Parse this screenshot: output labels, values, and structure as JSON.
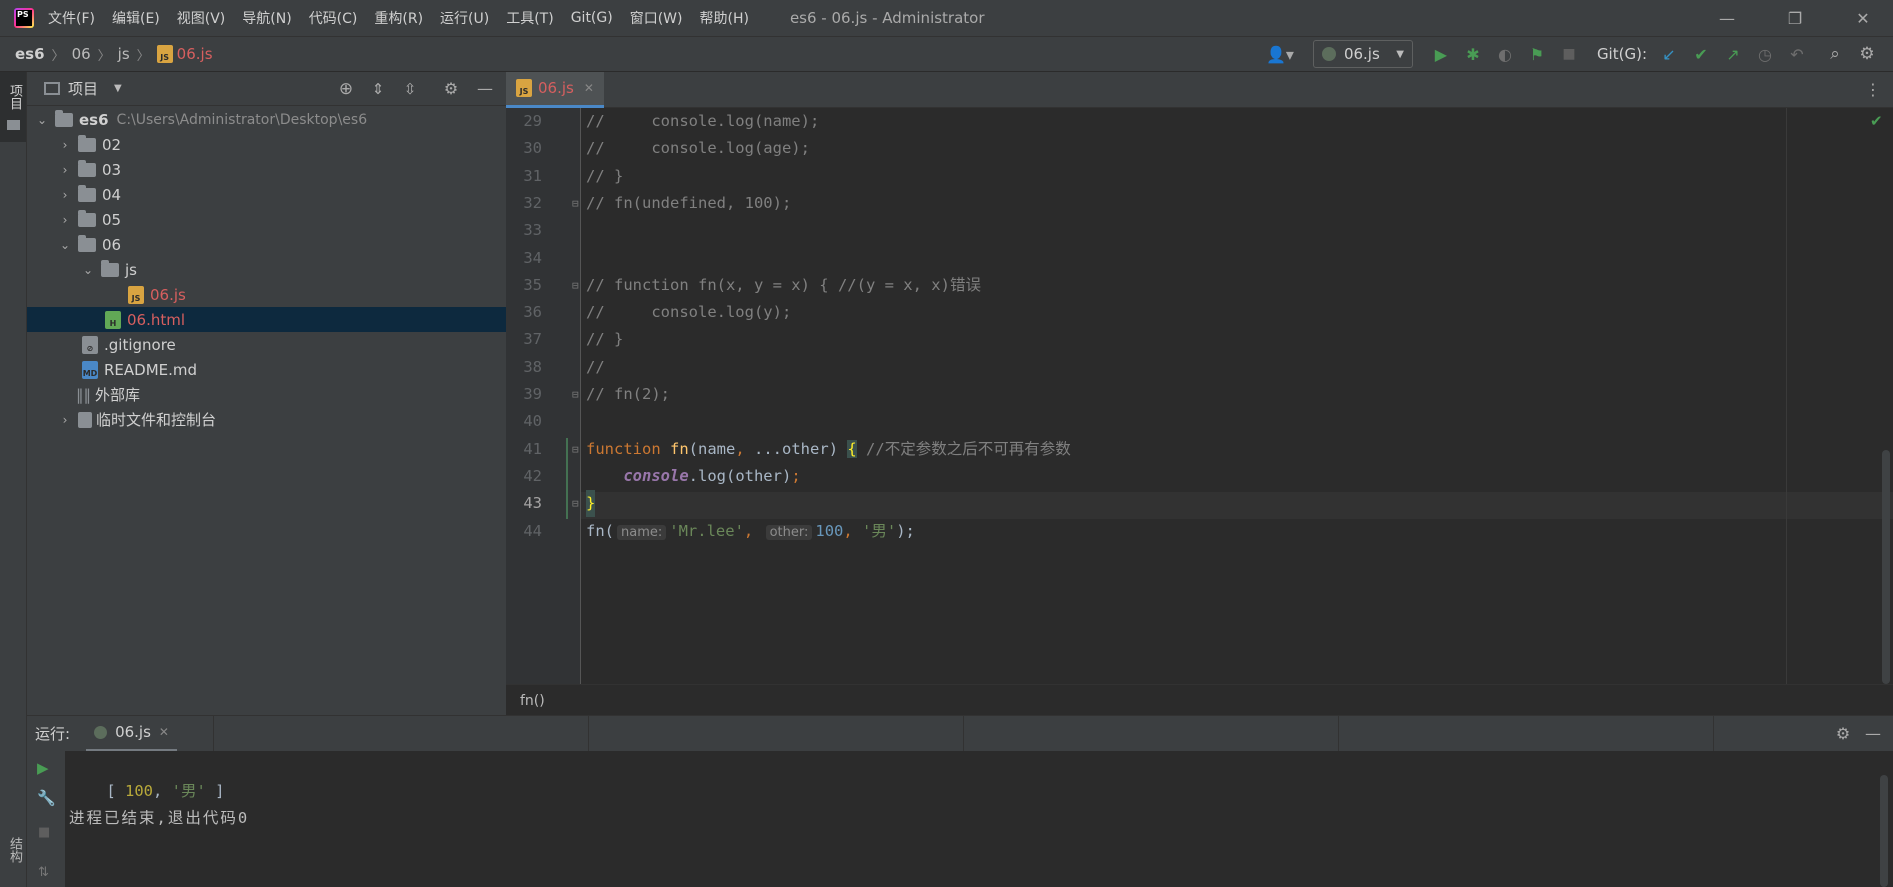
{
  "app_logo": "PS",
  "menu": [
    "文件(F)",
    "编辑(E)",
    "视图(V)",
    "导航(N)",
    "代码(C)",
    "重构(R)",
    "运行(U)",
    "工具(T)",
    "Git(G)",
    "窗口(W)",
    "帮助(H)"
  ],
  "window_title": "es6 - 06.js - Administrator",
  "window_controls": {
    "minimize": "—",
    "restore": "❐",
    "close": "✕"
  },
  "breadcrumb": [
    "es6",
    "06",
    "js",
    "06.js"
  ],
  "toolbar": {
    "run_config": "06.js",
    "git_label": "Git(G):"
  },
  "project_panel": {
    "title": "项目",
    "root": {
      "name": "es6",
      "path": "C:\\Users\\Administrator\\Desktop\\es6"
    },
    "folders": [
      "02",
      "03",
      "04",
      "05",
      "06"
    ],
    "sub_folder": "js",
    "js_file": "06.js",
    "html_file": "06.html",
    "files": [
      ".gitignore",
      "README.md"
    ],
    "external_libs": "外部库",
    "scratches": "临时文件和控制台"
  },
  "editor": {
    "tab": "06.js",
    "line_numbers": [
      "29",
      "30",
      "31",
      "32",
      "33",
      "34",
      "35",
      "36",
      "37",
      "38",
      "39",
      "40",
      "41",
      "42",
      "43",
      "44"
    ],
    "lines": {
      "l29": "//     console.log(name);",
      "l30": "//     console.log(age);",
      "l31": "// }",
      "l32": "// fn(undefined, 100);",
      "l35": "// function fn(x, y = x) { //(y = x, x)错误",
      "l36": "//     console.log(y);",
      "l37": "// }",
      "l38": "//",
      "l39": "// fn(2);",
      "l41": {
        "kw": "function",
        "name": "fn",
        "open": "(",
        "p1": "name",
        "comma": ",",
        "rest": " ...other",
        "close": ") ",
        "brace": "{",
        "comment": " //不定参数之后不可再有参数"
      },
      "l42": {
        "obj": "console",
        "method": ".log(other)",
        "semi": ";"
      },
      "l43": "}",
      "l44": {
        "call": "fn(",
        "hint1": "name:",
        "arg1": "'Mr.lee'",
        "comma1": ", ",
        "hint2": "other:",
        "arg2": "100",
        "comma2": ", ",
        "arg3": "'男'",
        "end": ");"
      }
    },
    "code_breadcrumb": "fn()"
  },
  "run_panel": {
    "label": "运行:",
    "tab": "06.js",
    "output": {
      "open": "[ ",
      "num": "100",
      "sep": ", ",
      "str": "'男'",
      "close": " ]"
    },
    "exit_message": "进程已结束,退出代码0"
  },
  "side_tabs": {
    "project": "项目",
    "structure": "结构"
  }
}
